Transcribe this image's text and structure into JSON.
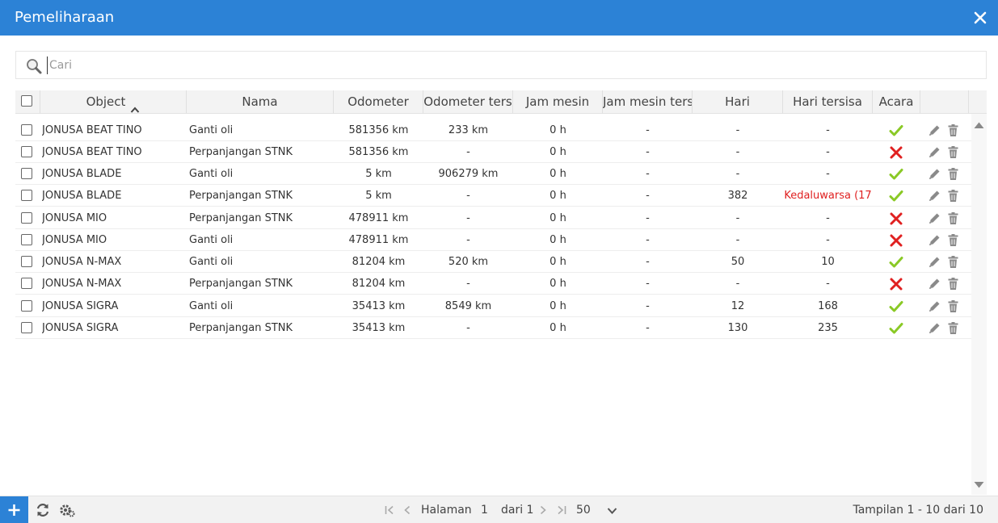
{
  "window": {
    "title": "Pemeliharaan"
  },
  "search": {
    "placeholder": "Cari",
    "value": ""
  },
  "columns": {
    "object": "Object",
    "nama": "Nama",
    "odometer": "Odometer",
    "odometer_ters": "Odometer ters",
    "jam_mesin": "Jam mesin",
    "jam_mesin_ters": "Jam mesin ters",
    "hari": "Hari",
    "hari_tersisa": "Hari tersisa",
    "acara": "Acara"
  },
  "sort": {
    "column": "object",
    "direction": "ascending",
    "icon": "chevron-up-icon"
  },
  "rows": [
    {
      "object": "JONUSA BEAT TINO",
      "nama": "Ganti oli",
      "odometer": "581356 km",
      "odometer_ters": "233 km",
      "jam_mesin": "0 h",
      "jam_mesin_ters": "-",
      "hari": "-",
      "hari_tersisa": "-",
      "acara": "check"
    },
    {
      "object": "JONUSA BEAT TINO",
      "nama": "Perpanjangan STNK",
      "odometer": "581356 km",
      "odometer_ters": "-",
      "jam_mesin": "0 h",
      "jam_mesin_ters": "-",
      "hari": "-",
      "hari_tersisa": "-",
      "acara": "cross"
    },
    {
      "object": "JONUSA BLADE",
      "nama": "Ganti oli",
      "odometer": "5 km",
      "odometer_ters": "906279 km",
      "jam_mesin": "0 h",
      "jam_mesin_ters": "-",
      "hari": "-",
      "hari_tersisa": "-",
      "acara": "check"
    },
    {
      "object": "JONUSA BLADE",
      "nama": "Perpanjangan STNK",
      "odometer": "5 km",
      "odometer_ters": "-",
      "jam_mesin": "0 h",
      "jam_mesin_ters": "-",
      "hari": "382",
      "hari_tersisa": "Kedaluwarsa (17",
      "acara": "check",
      "expired": true
    },
    {
      "object": "JONUSA MIO",
      "nama": "Perpanjangan STNK",
      "odometer": "478911 km",
      "odometer_ters": "-",
      "jam_mesin": "0 h",
      "jam_mesin_ters": "-",
      "hari": "-",
      "hari_tersisa": "-",
      "acara": "cross"
    },
    {
      "object": "JONUSA MIO",
      "nama": "Ganti oli",
      "odometer": "478911 km",
      "odometer_ters": "-",
      "jam_mesin": "0 h",
      "jam_mesin_ters": "-",
      "hari": "-",
      "hari_tersisa": "-",
      "acara": "cross"
    },
    {
      "object": "JONUSA N-MAX",
      "nama": "Ganti oli",
      "odometer": "81204 km",
      "odometer_ters": "520 km",
      "jam_mesin": "0 h",
      "jam_mesin_ters": "-",
      "hari": "50",
      "hari_tersisa": "10",
      "acara": "check"
    },
    {
      "object": "JONUSA N-MAX",
      "nama": "Perpanjangan STNK",
      "odometer": "81204 km",
      "odometer_ters": "-",
      "jam_mesin": "0 h",
      "jam_mesin_ters": "-",
      "hari": "-",
      "hari_tersisa": "-",
      "acara": "cross"
    },
    {
      "object": "JONUSA SIGRA",
      "nama": "Ganti oli",
      "odometer": "35413 km",
      "odometer_ters": "8549 km",
      "jam_mesin": "0 h",
      "jam_mesin_ters": "-",
      "hari": "12",
      "hari_tersisa": "168",
      "acara": "check"
    },
    {
      "object": "JONUSA SIGRA",
      "nama": "Perpanjangan STNK",
      "odometer": "35413 km",
      "odometer_ters": "-",
      "jam_mesin": "0 h",
      "jam_mesin_ters": "-",
      "hari": "130",
      "hari_tersisa": "235",
      "acara": "check"
    }
  ],
  "pagination": {
    "page_label": "Halaman",
    "page": "1",
    "of_label": "dari 1",
    "page_size": "50",
    "summary": "Tampilan 1 - 10 dari 10"
  },
  "icons": {
    "close": "close-icon",
    "search": "search-icon",
    "edit": "pencil-icon",
    "delete": "trash-icon",
    "add": "plus-icon",
    "refresh": "refresh-icon",
    "settings": "gear-icon",
    "event_ok": "check-icon",
    "event_fail": "cross-icon"
  },
  "colors": {
    "header": "#2c82d6",
    "check": "#8ac926",
    "cross": "#e02020",
    "expired": "#e02020"
  }
}
